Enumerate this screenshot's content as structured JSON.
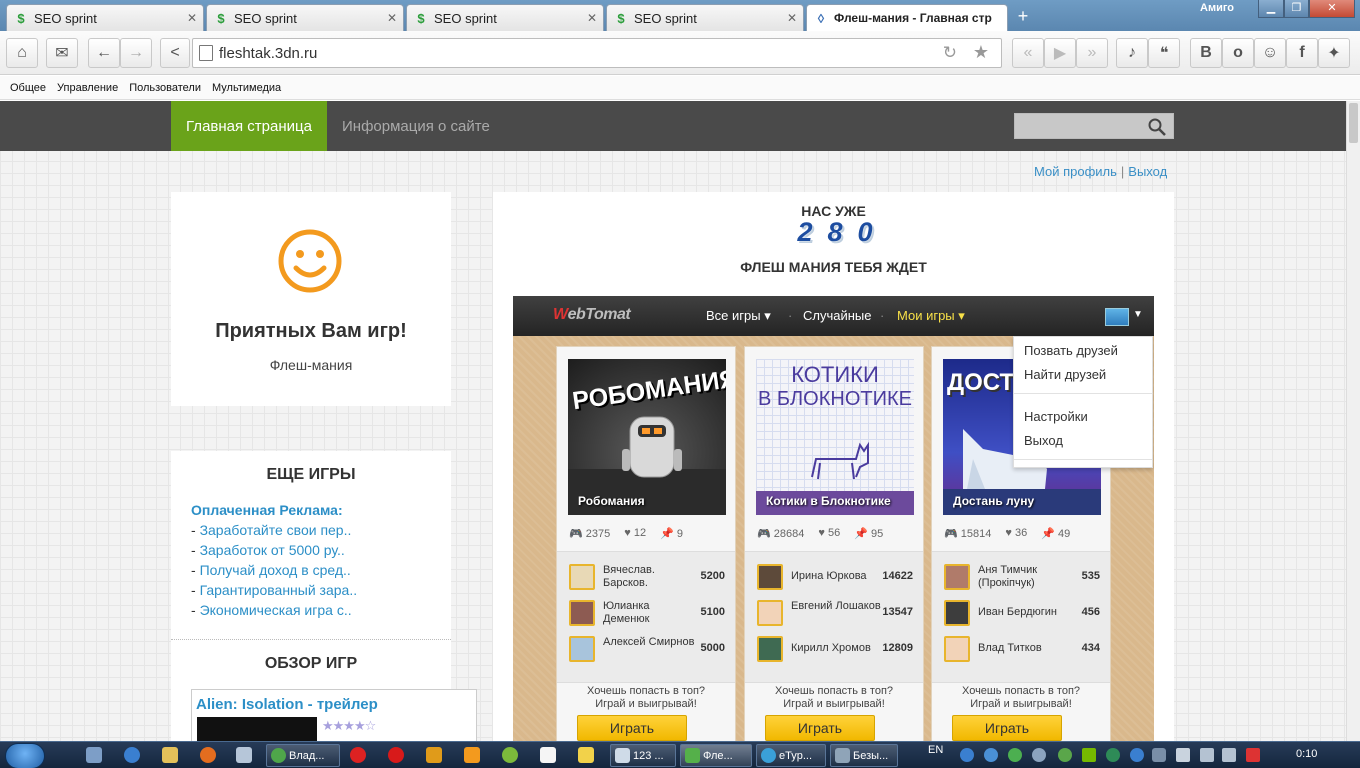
{
  "browser": {
    "tabs": [
      {
        "title": "SEO sprint",
        "favicon": "dollar-icon"
      },
      {
        "title": "SEO sprint",
        "favicon": "dollar-icon"
      },
      {
        "title": "SEO sprint",
        "favicon": "dollar-icon"
      },
      {
        "title": "SEO sprint",
        "favicon": "dollar-icon"
      },
      {
        "title": "Флеш-мания - Главная стр",
        "favicon": "site-icon"
      }
    ],
    "window_title": "Амиго",
    "url": "fleshtak.3dn.ru",
    "bookmarks": [
      "Общее",
      "Управление",
      "Пользователи",
      "Мультимедиа"
    ]
  },
  "site": {
    "nav": {
      "home": "Главная страница",
      "info": "Информация о сайте"
    },
    "profile_links": {
      "profile": "Мой профиль",
      "separator": "|",
      "logout": "Выход"
    },
    "welcome": {
      "title": "Приятных Вам игр!",
      "subtitle": "Флеш-мания"
    },
    "more_games": {
      "heading": "ЕЩЕ ИГРЫ",
      "ads_heading": "Оплаченная Реклама:",
      "ads": [
        "Заработайте свои пер..",
        "Заработок от 5000 ру..",
        "Получай доход в сред..",
        "Гарантированный зара..",
        "Экономическая игра с.."
      ]
    },
    "review": {
      "heading": "ОБЗОР ИГР",
      "title": "Alien: Isolation - трейлер",
      "rating": 4,
      "rating_max": 5
    },
    "counter": {
      "heading": "НАС УЖЕ",
      "digits": [
        "2",
        "8",
        "0"
      ],
      "subheading": "ФЛЕШ МАНИЯ ТЕБЯ ЖДЕТ"
    }
  },
  "widget": {
    "logo_prefix": "W",
    "logo": "ebTomat",
    "menu": {
      "all_games": "Все игры",
      "random": "Случайные",
      "my_games": "Мои игры"
    },
    "dropdown": [
      "Позвать друзей",
      "Найти друзей",
      "Настройки",
      "Выход"
    ],
    "cards": [
      {
        "title": "Робомания",
        "image_text": "РОБОМАНИЯ",
        "plays": "2375",
        "likes": "12",
        "pins": "9",
        "leaders": [
          {
            "name": "Вячеслав. Барсков.",
            "score": "5200"
          },
          {
            "name": "Юлианка Деменюк",
            "score": "5100"
          },
          {
            "name": "Алексей Смирнов",
            "score": "5000"
          }
        ],
        "cta_line1": "Хочешь попасть в топ?",
        "cta_line2": "Играй и выигрывай!",
        "button": "Играть"
      },
      {
        "title": "Котики в Блокнотике",
        "image_text_1": "КОТИКИ",
        "image_text_2": "В БЛОКНОТИКЕ",
        "plays": "28684",
        "likes": "56",
        "pins": "95",
        "leaders": [
          {
            "name": "Ирина Юркова",
            "score": "14622"
          },
          {
            "name": "Евгений Лошаков",
            "score": "13547"
          },
          {
            "name": "Кирилл Хромов",
            "score": "12809"
          }
        ],
        "cta_line1": "Хочешь попасть в топ?",
        "cta_line2": "Играй и выигрывай!",
        "button": "Играть"
      },
      {
        "title": "Достань луну",
        "image_text": "ДОСТА",
        "plays": "15814",
        "likes": "36",
        "pins": "49",
        "leaders": [
          {
            "name": "Аня Тимчик (Прокiпчук)",
            "score": "535"
          },
          {
            "name": "Иван Бердюгин",
            "score": "456"
          },
          {
            "name": "Влад Титков",
            "score": "434"
          }
        ],
        "cta_line1": "Хочешь попасть в топ?",
        "cta_line2": "Играй и выигрывай!",
        "button": "Играть"
      }
    ]
  },
  "taskbar": {
    "apps": [
      "Влад...",
      "123 ...",
      "Фле...",
      "eTyp...",
      "Безы..."
    ],
    "language": "EN",
    "clock": "0:10"
  },
  "colors": {
    "nav_active": "#6aa31a",
    "nav_bg": "#4a4a4a",
    "link": "#2c8fc7",
    "play_button": "#f1b800",
    "smiley": "#f39a1e"
  }
}
